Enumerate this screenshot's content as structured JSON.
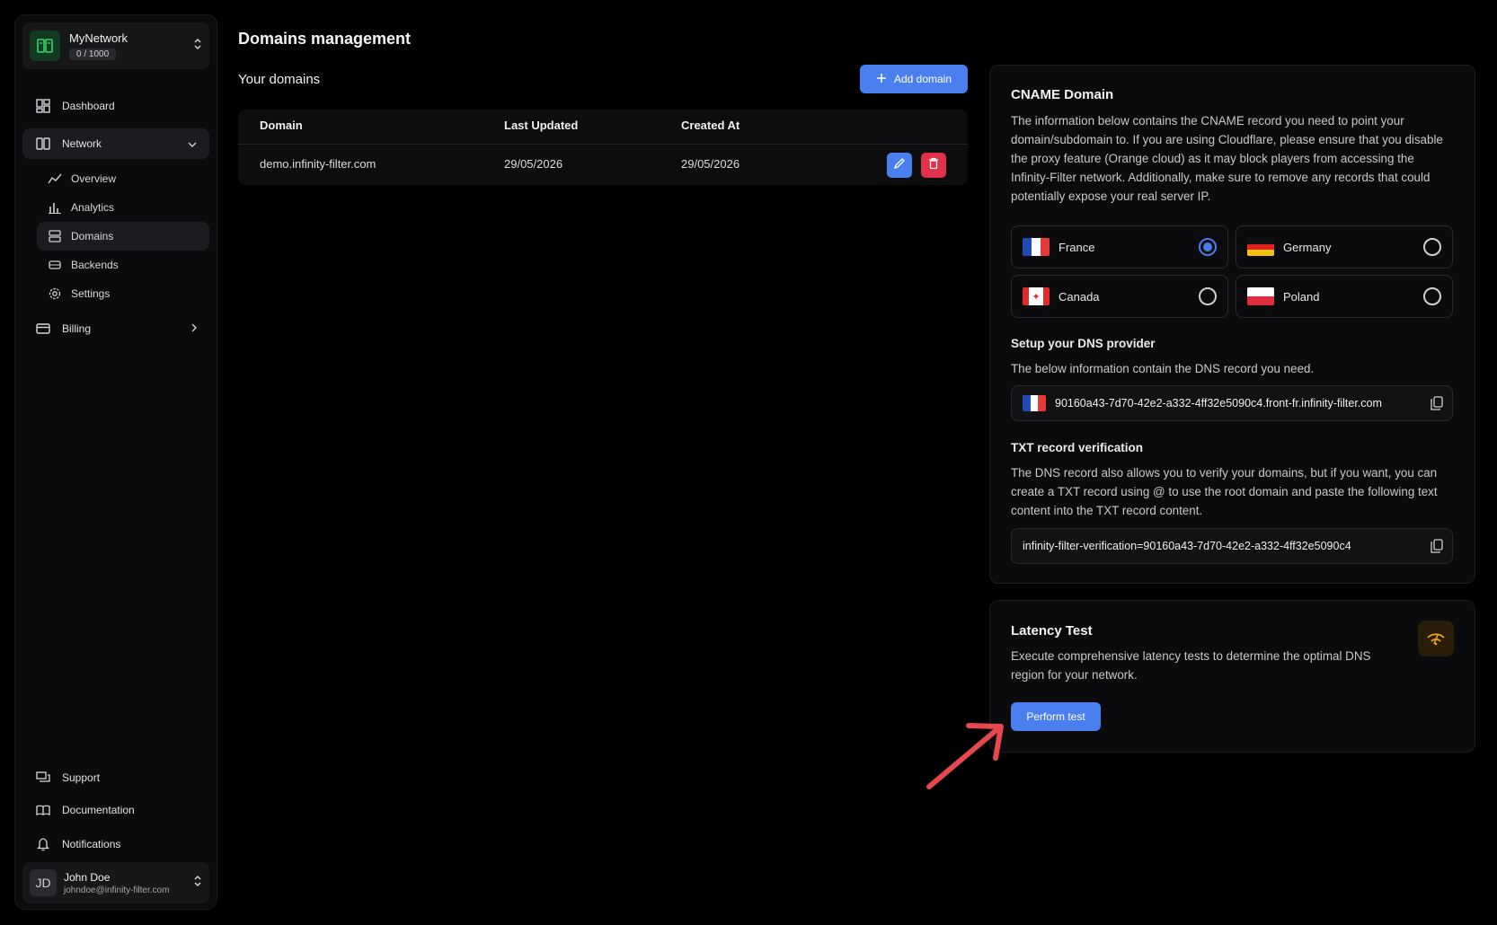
{
  "network": {
    "name": "MyNetwork",
    "usage": "0 / 1000"
  },
  "sidebar": {
    "dashboard": "Dashboard",
    "network": "Network",
    "sub": [
      "Overview",
      "Analytics",
      "Domains",
      "Backends",
      "Settings"
    ],
    "billing": "Billing",
    "bottom": [
      "Support",
      "Documentation",
      "Notifications"
    ]
  },
  "user": {
    "initials": "JD",
    "name": "John Doe",
    "email": "johndoe@infinity-filter.com"
  },
  "page": {
    "title": "Domains management",
    "section": "Your domains",
    "add_button": "Add domain"
  },
  "table": {
    "headers": [
      "Domain",
      "Last Updated",
      "Created At"
    ],
    "rows": [
      {
        "domain": "demo.infinity-filter.com",
        "updated": "29/05/2026",
        "created": "29/05/2026"
      }
    ]
  },
  "cname": {
    "title": "CNAME Domain",
    "description": "The information below contains the CNAME record you need to point your domain/subdomain to. If you are using Cloudflare, please ensure that you disable the proxy feature (Orange cloud) as it may block players from accessing the Infinity-Filter network. Additionally, make sure to remove any records that could potentially expose your real server IP.",
    "regions": [
      {
        "name": "France",
        "selected": true
      },
      {
        "name": "Germany",
        "selected": false
      },
      {
        "name": "Canada",
        "selected": false
      },
      {
        "name": "Poland",
        "selected": false
      }
    ],
    "dns_title": "Setup your DNS provider",
    "dns_desc": "The below information contain the DNS record you need.",
    "dns_value": "90160a43-7d70-42e2-a332-4ff32e5090c4.front-fr.infinity-filter.com",
    "txt_title": "TXT record verification",
    "txt_desc": "The DNS record also allows you to verify your domains, but if you want, you can create a TXT record using @ to use the root domain and paste the following text content into the TXT record content.",
    "txt_value": "infinity-filter-verification=90160a43-7d70-42e2-a332-4ff32e5090c4"
  },
  "latency": {
    "title": "Latency Test",
    "description": "Execute comprehensive latency tests to determine the optimal DNS region for your network.",
    "button": "Perform test"
  },
  "colors": {
    "accent": "#4a7ff0",
    "danger": "#e0304a",
    "annotation": "#e5484d"
  }
}
